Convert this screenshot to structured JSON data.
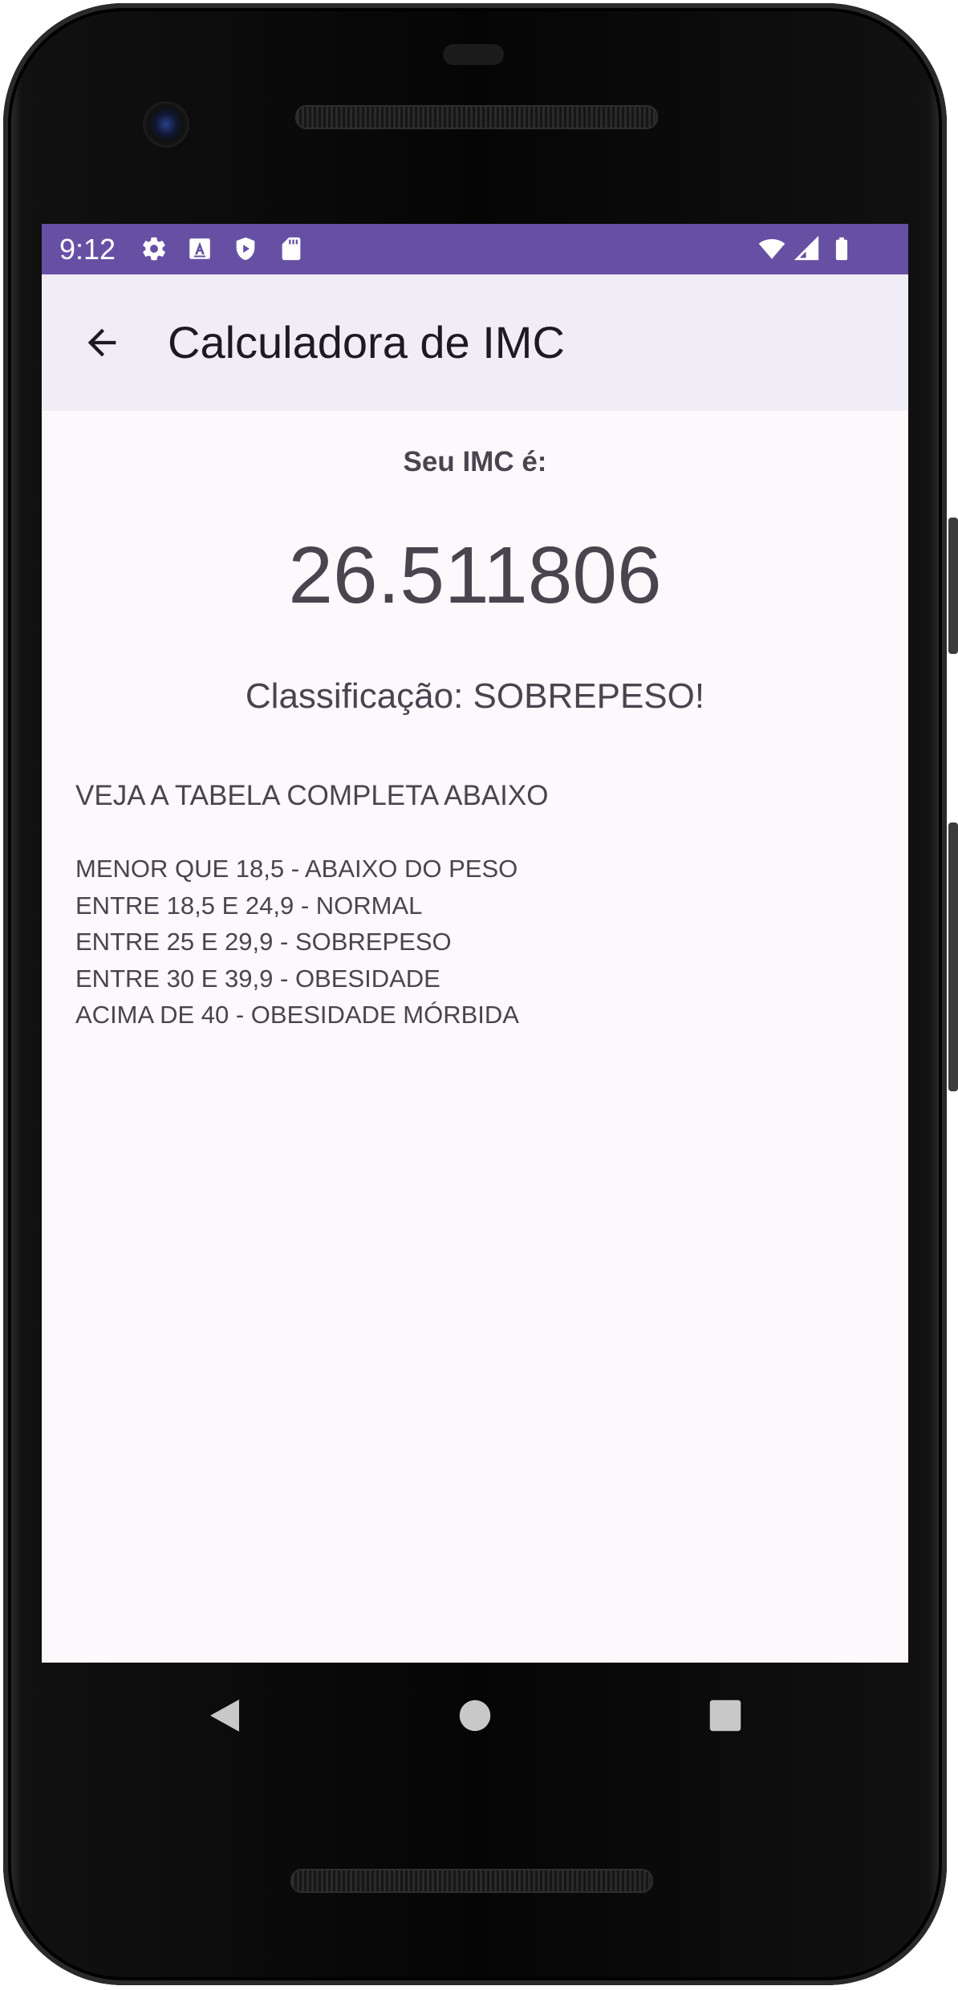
{
  "status_bar": {
    "time": "9:12",
    "left_icons": [
      "gear-icon",
      "font-a-icon",
      "play-protect-icon",
      "sd-card-icon"
    ],
    "right_icons": [
      "wifi-icon",
      "cellular-signal-icon",
      "battery-icon"
    ],
    "background_color": "#6750a4"
  },
  "app_bar": {
    "title": "Calculadora de IMC",
    "back_icon": "arrow-back-icon",
    "background_color": "#f1edf6"
  },
  "result": {
    "label": "Seu IMC é:",
    "value": "26.511806",
    "classification": "Classificação: SOBREPESO!"
  },
  "reference_table": {
    "heading": "VEJA A TABELA COMPLETA ABAIXO",
    "rows": [
      "MENOR QUE 18,5 - ABAIXO DO PESO",
      "ENTRE 18,5 E 24,9 - NORMAL",
      "ENTRE 25 E 29,9 - SOBREPESO",
      "ENTRE 30 E 39,9 - OBESIDADE",
      "ACIMA DE 40 - OBESIDADE MÓRBIDA"
    ]
  },
  "nav_bar": {
    "buttons": [
      "back-triangle-icon",
      "home-circle-icon",
      "recents-square-icon"
    ]
  }
}
